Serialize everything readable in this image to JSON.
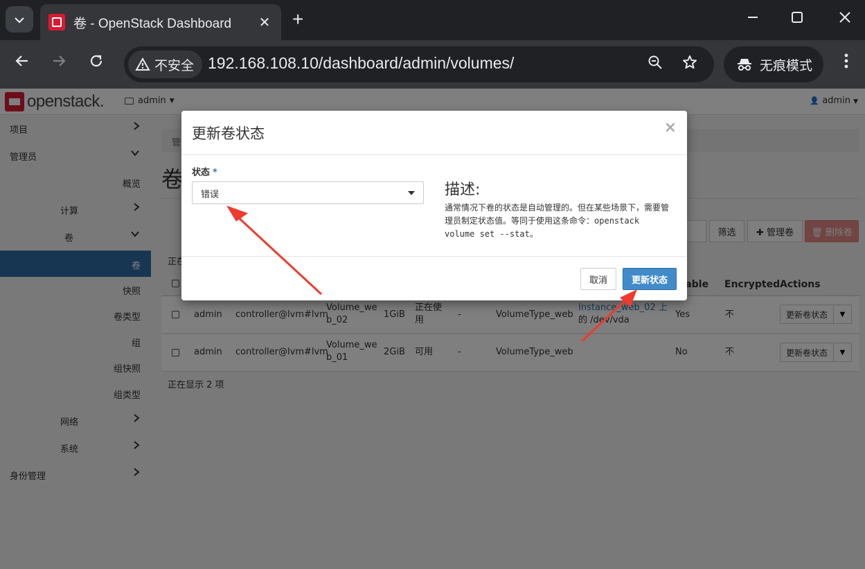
{
  "browser": {
    "tab_title": "卷 - OpenStack Dashboard",
    "tab_close": "✕",
    "new_tab": "+",
    "security_label": "不安全",
    "url": "192.168.108.10/dashboard/admin/volumes/",
    "incognito_label": "无痕模式",
    "icons": [
      "chevron-down-icon",
      "back-icon",
      "forward-icon",
      "reload-icon",
      "warning-icon",
      "zoom-icon",
      "star-icon",
      "incognito-icon",
      "kebab-menu-icon",
      "minimize-icon",
      "maximize-icon",
      "close-icon"
    ]
  },
  "navbar": {
    "brand": "openstack.",
    "project": "admin",
    "user": "admin"
  },
  "sidebar": {
    "items": [
      {
        "label": "项目",
        "chevron": "›"
      },
      {
        "label": "管理员",
        "chevron": "⌄"
      },
      {
        "label": "概览"
      },
      {
        "label": "计算",
        "chevron": "›"
      },
      {
        "label": "卷",
        "chevron": "⌄"
      },
      {
        "label": "卷"
      },
      {
        "label": "快照"
      },
      {
        "label": "卷类型"
      },
      {
        "label": "组"
      },
      {
        "label": "组快照"
      },
      {
        "label": "组类型"
      },
      {
        "label": "网络",
        "chevron": "›"
      },
      {
        "label": "系统",
        "chevron": "›"
      },
      {
        "label": "身份管理",
        "chevron": "›"
      }
    ]
  },
  "content": {
    "breadcrumb": "管",
    "title": "卷",
    "filter_btn": "筛选",
    "manage_btn": "✚ 管理卷",
    "delete_btn": "🗑 删除卷",
    "showing_top": "正在",
    "showing_bottom": "正在显示 2 项",
    "headers": {
      "bootable": "otable",
      "encrypted": "Encrypted",
      "actions": "Actions"
    },
    "rows": [
      {
        "project": "admin",
        "host": "controller@lvm#lvm",
        "name_line1": "Volume_we",
        "name_line2": "b_02",
        "size": "1GiB",
        "status_line1": "正在使",
        "status_line2": "用",
        "group": "-",
        "type": "VolumeType_web",
        "attached_line1": "Instance_web_02 上",
        "attached_line2": "的 /dev/vda",
        "bootable": "Yes",
        "encrypted": "不",
        "action": "更新卷状态"
      },
      {
        "project": "admin",
        "host": "controller@lvm#lvm",
        "name_line1": "Volume_we",
        "name_line2": "b_01",
        "size": "2GiB",
        "status_line1": "可用",
        "status_line2": "",
        "group": "-",
        "type": "VolumeType_web",
        "attached_line1": "",
        "attached_line2": "",
        "bootable": "No",
        "encrypted": "不",
        "action": "更新卷状态"
      }
    ]
  },
  "modal": {
    "title": "更新卷状态",
    "close": "×",
    "status_label": "状态",
    "required_mark": "*",
    "status_value": "错误",
    "desc_title": "描述:",
    "desc_text_1": "通常情况下卷的状态是自动管理的。但在某些场景下，需要管理员制定状态值。等同于使用这条命令：",
    "desc_cmd": "openstack volume set --stat",
    "desc_text_2": "。",
    "cancel": "取消",
    "submit": "更新状态"
  },
  "colors": {
    "brand_red": "#da1a32",
    "active_nav": "#2e6da4",
    "primary": "#428bca",
    "link": "#337ab7",
    "annotation_arrow": "#f03a2e"
  }
}
